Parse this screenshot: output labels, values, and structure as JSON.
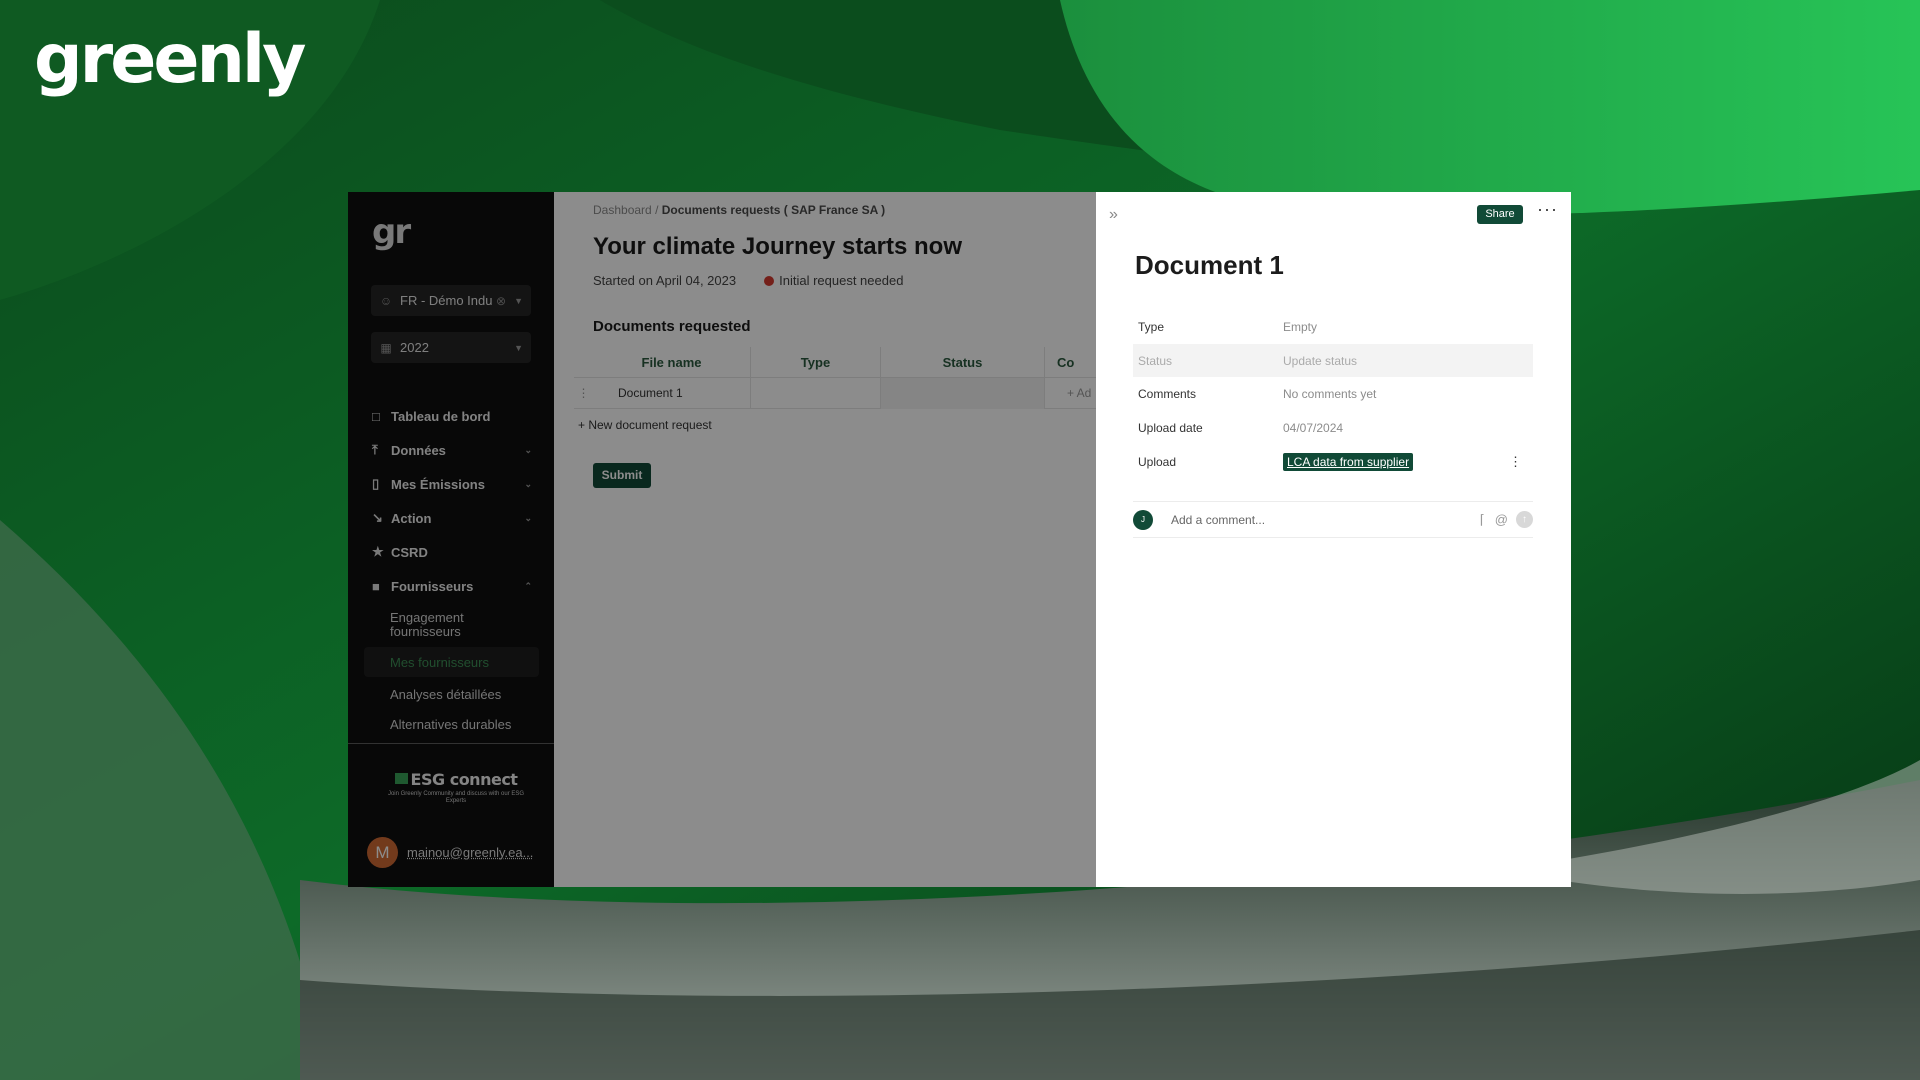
{
  "brand": {
    "logo_text": "greenly"
  },
  "sidebar": {
    "logo_text": "gr",
    "entity_select": {
      "value": "FR - Démo Indu",
      "icon": "user-icon"
    },
    "year_select": {
      "value": "2022",
      "icon": "calendar-icon"
    },
    "items": [
      {
        "label": "Tableau de bord",
        "icon": "square-icon"
      },
      {
        "label": "Données",
        "icon": "upload-icon"
      },
      {
        "label": "Mes Émissions",
        "icon": "bar-chart-icon"
      },
      {
        "label": "Action",
        "icon": "trend-down-icon"
      },
      {
        "label": "CSRD",
        "icon": "star-icon"
      },
      {
        "label": "Fournisseurs",
        "icon": "folder-icon"
      }
    ],
    "subitems": [
      {
        "label": "Engagement fournisseurs"
      },
      {
        "label": "Mes fournisseurs"
      },
      {
        "label": "Analyses détaillées"
      },
      {
        "label": "Alternatives durables"
      }
    ],
    "esg": {
      "title": "ESG connect",
      "subtitle": "Join Greenly Community and discuss with our ESG Experts"
    },
    "user": {
      "initial": "M",
      "email": "mainou@greenly.ea..."
    }
  },
  "main": {
    "breadcrumb": {
      "root": "Dashboard",
      "sep": "/",
      "current": "Documents requests ( SAP France SA )"
    },
    "title": "Your climate Journey starts now",
    "started": "Started on April 04, 2023",
    "status": "Initial request needed",
    "section_title": "Documents requested",
    "table": {
      "headers": [
        "File name",
        "Type",
        "Status",
        "Co"
      ],
      "rows": [
        {
          "file": "Document 1",
          "type": "",
          "status": "",
          "add": "+ Ad"
        }
      ]
    },
    "new_request": "New document request",
    "submit": "Submit"
  },
  "panel": {
    "share": "Share",
    "title": "Document 1",
    "props": [
      {
        "key": "Type",
        "value": "Empty"
      },
      {
        "key": "Status",
        "value": "Update status"
      },
      {
        "key": "Comments",
        "value": "No comments yet"
      },
      {
        "key": "Upload date",
        "value": "04/07/2024"
      },
      {
        "key": "Upload",
        "value": "LCA data from supplier"
      }
    ],
    "comment": {
      "avatar": "J",
      "placeholder": "Add a comment..."
    }
  },
  "colors": {
    "brand_green": "#114a37",
    "status_red": "#d43a2f"
  }
}
